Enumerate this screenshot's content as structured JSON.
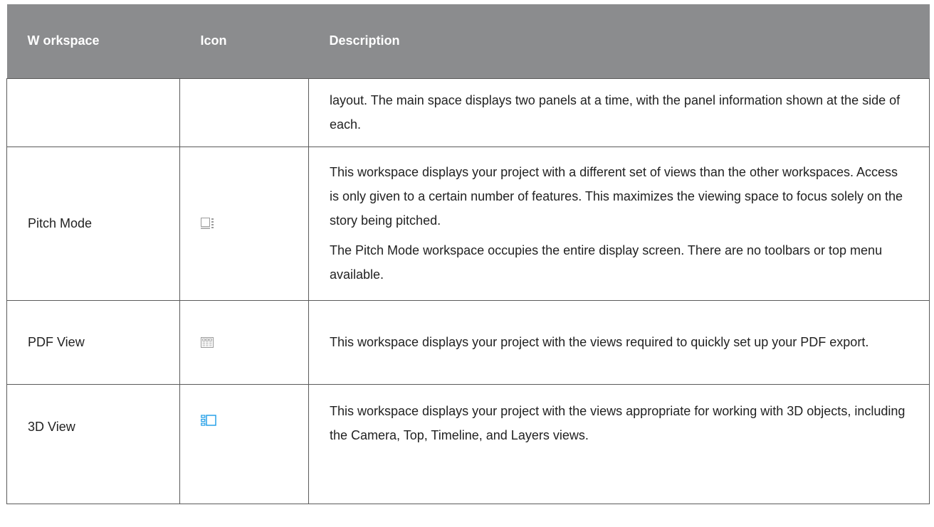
{
  "headers": {
    "workspace": "W orkspace",
    "icon": "Icon",
    "description": "Description"
  },
  "rows": [
    {
      "workspace": "",
      "icon": "",
      "description": [
        "layout. The main space displays two panels at a time, with the panel information shown at the side of each."
      ]
    },
    {
      "workspace": "Pitch Mode",
      "icon": "pitch-mode-icon",
      "description": [
        "This workspace displays your project with a different set of views than the other workspaces. Access is only given to a certain number of features. This maximizes the viewing space to focus solely on the story being pitched.",
        "The Pitch Mode workspace occupies the entire display screen. There are no toolbars or top menu available."
      ]
    },
    {
      "workspace": "PDF View",
      "icon": "pdf-view-icon",
      "description": [
        "This workspace displays your project with the views required to quickly set up your PDF export."
      ]
    },
    {
      "workspace": "3D View",
      "icon": "3d-view-icon",
      "description": [
        "This workspace displays your project with the views appropriate for working with 3D objects, including the Camera, Top, Timeline, and Layers views."
      ]
    }
  ],
  "colors": {
    "header_bg": "#8b8c8e",
    "border": "#5a5a5a",
    "icon_grey": "#9a9a9a",
    "icon_blue": "#1a9be6"
  }
}
